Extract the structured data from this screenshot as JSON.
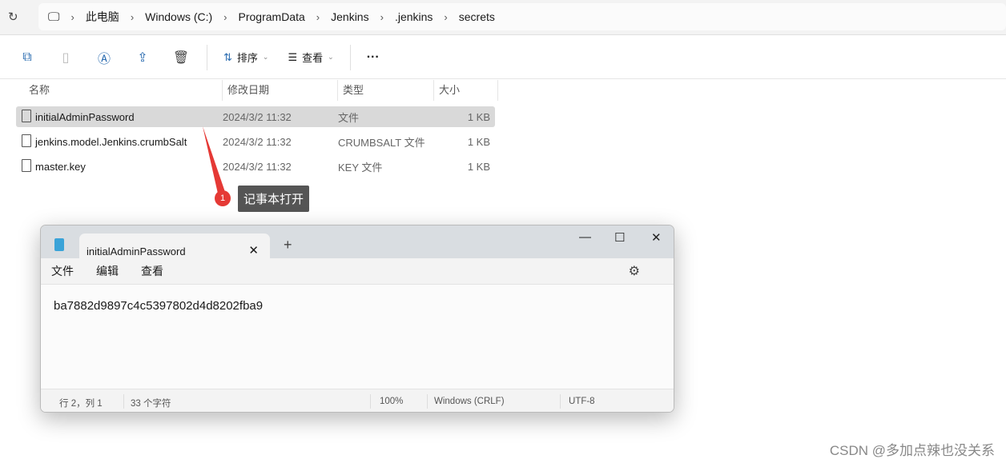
{
  "address": {
    "crumbs": [
      "此电脑",
      "Windows (C:)",
      "ProgramData",
      "Jenkins",
      ".jenkins",
      "secrets"
    ]
  },
  "toolbar": {
    "sort": "排序",
    "view": "查看",
    "more": "···"
  },
  "columns": [
    "名称",
    "修改日期",
    "类型",
    "大小"
  ],
  "files": [
    {
      "name": "initialAdminPassword",
      "date": "2024/3/2 11:32",
      "type": "文件",
      "size": "1 KB"
    },
    {
      "name": "jenkins.model.Jenkins.crumbSalt",
      "date": "2024/3/2 11:32",
      "type": "CRUMBSALT 文件",
      "size": "1 KB"
    },
    {
      "name": "master.key",
      "date": "2024/3/2 11:32",
      "type": "KEY 文件",
      "size": "1 KB"
    }
  ],
  "annotation": {
    "number": "1",
    "text": "记事本打开",
    "color": "#e53935"
  },
  "notepad": {
    "tab": "initialAdminPassword",
    "menu": [
      "文件",
      "编辑",
      "查看"
    ],
    "content": "ba7882d9897c4c5397802d4d8202fba9",
    "status": {
      "pos": "行 2，列 1",
      "chars": "33 个字符",
      "zoom": "100%",
      "eol": "Windows (CRLF)",
      "enc": "UTF-8"
    }
  },
  "watermark": "CSDN @多加点辣也没关系"
}
